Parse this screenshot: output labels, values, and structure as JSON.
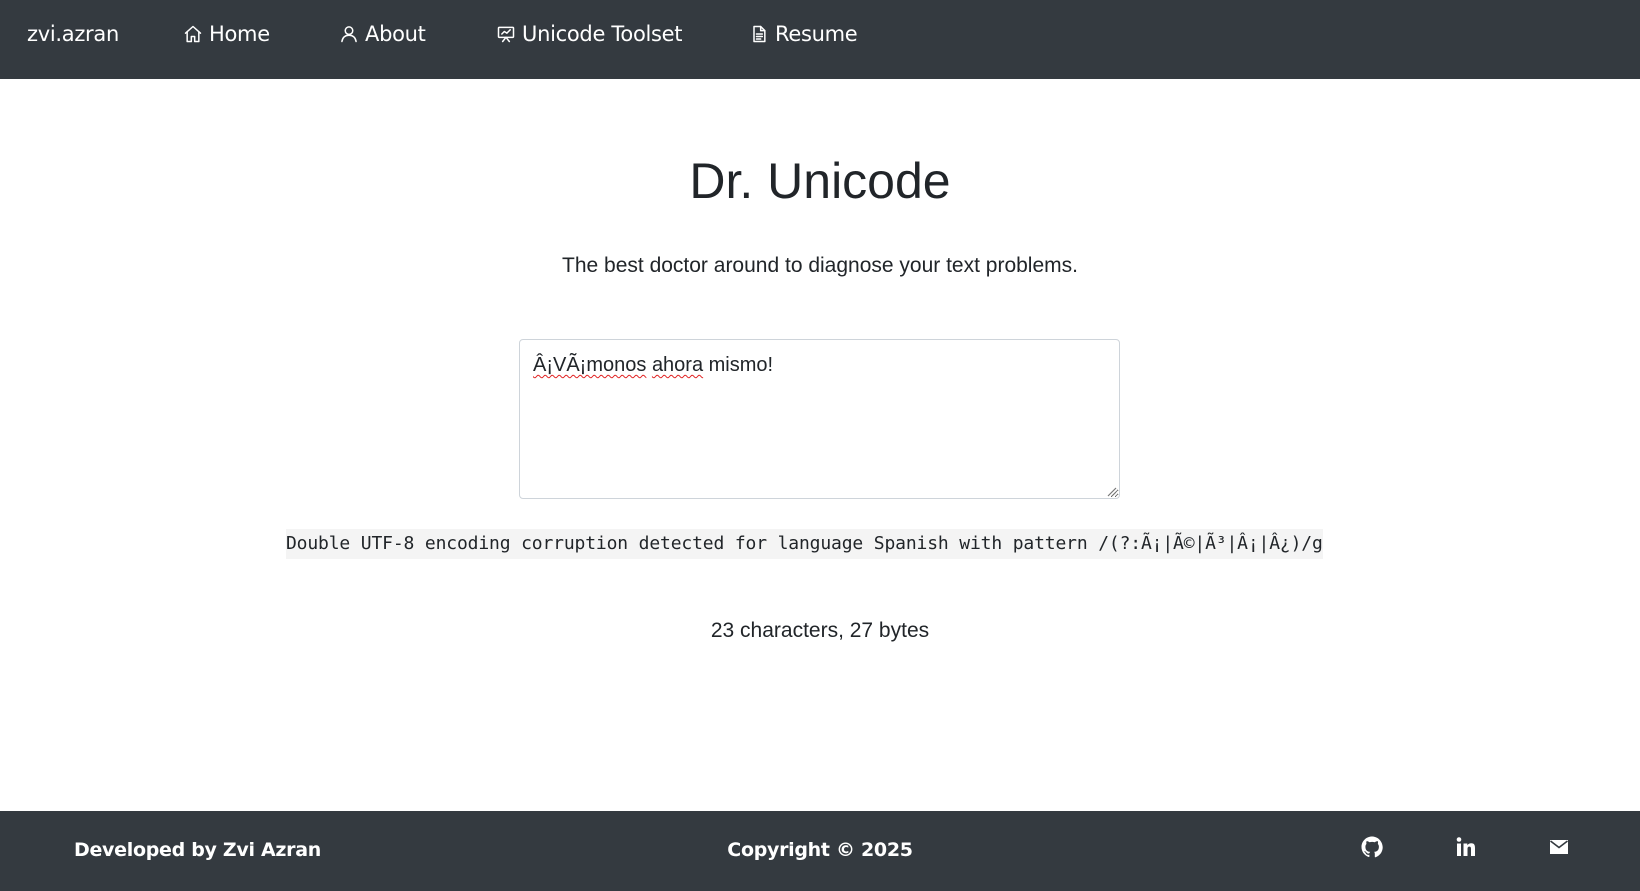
{
  "navbar": {
    "brand": "zvi.azran",
    "items": [
      {
        "label": "Home",
        "icon": "home-icon"
      },
      {
        "label": "About",
        "icon": "user-icon"
      },
      {
        "label": "Unicode Toolset",
        "icon": "presentation-icon"
      },
      {
        "label": "Resume",
        "icon": "document-icon"
      }
    ]
  },
  "main": {
    "title": "Dr. Unicode",
    "subtitle": "The best doctor around to diagnose your text problems.",
    "input_value_parts": [
      "Â¡VÃ¡monos",
      " ",
      "ahora",
      " mismo!"
    ],
    "diagnosis": "Double UTF-8 encoding corruption detected for language Spanish with pattern /(?:Ã¡|Ã©|Ã³|Â¡|Â¿)/g",
    "counts": "23 characters, 27 bytes"
  },
  "footer": {
    "developer": "Developed by Zvi Azran",
    "copyright": "Copyright © 2025",
    "icons": [
      "github-icon",
      "linkedin-icon",
      "mail-icon"
    ]
  },
  "colors": {
    "navbar_bg": "#343a40",
    "footer_bg": "#343a40",
    "text": "#212529",
    "diag_bg": "#f4f4f4"
  }
}
